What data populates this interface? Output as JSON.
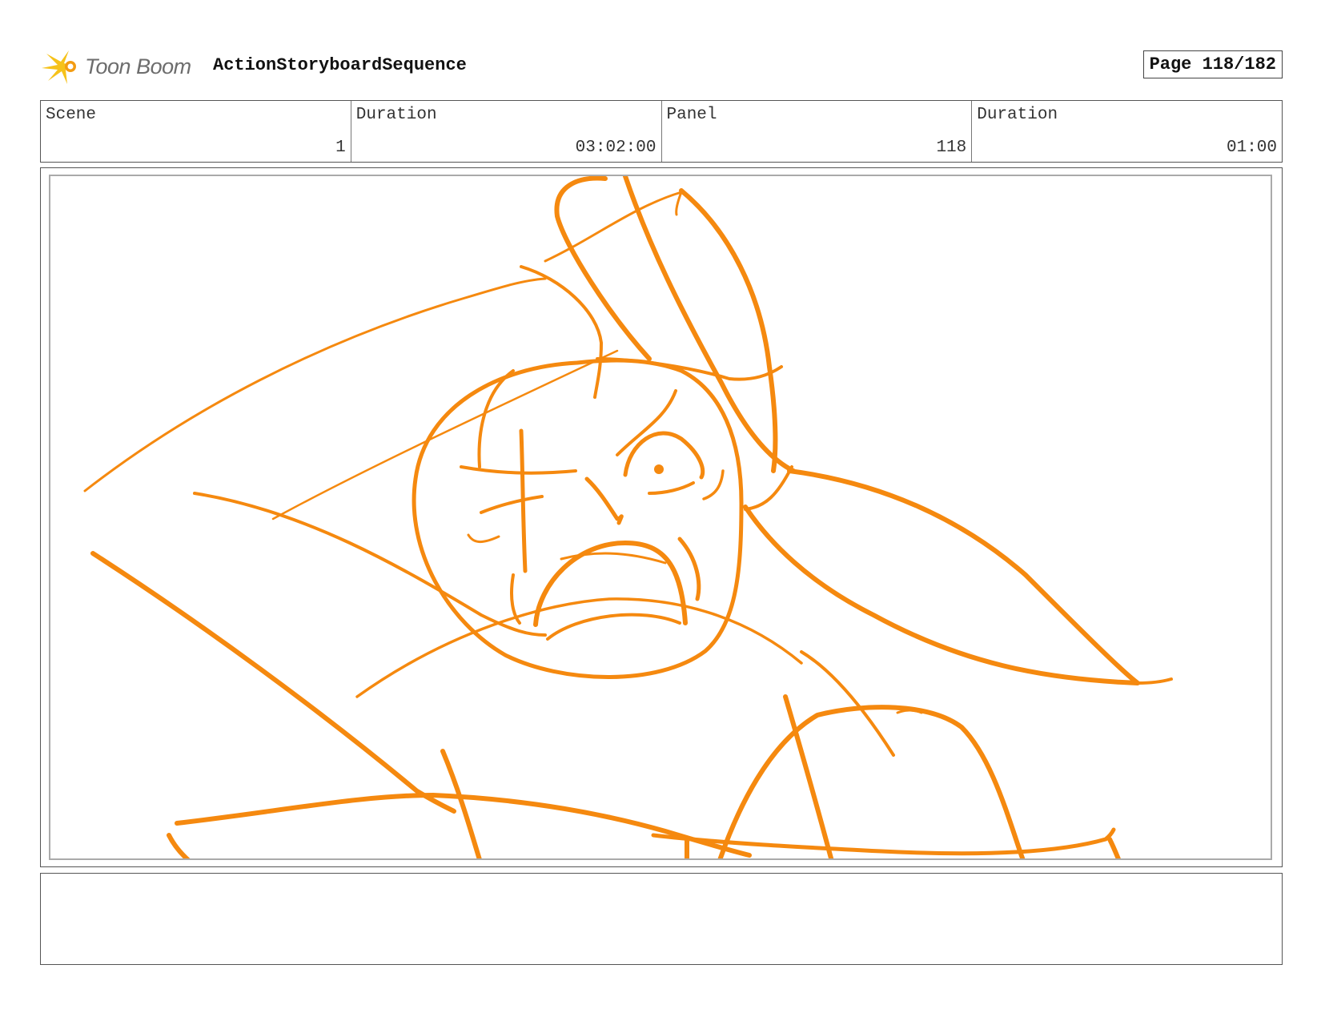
{
  "header": {
    "brand_name": "Toon Boom",
    "project_title": "ActionStoryboardSequence",
    "page_label": "Page 118/182"
  },
  "info": {
    "scene_label": "Scene",
    "scene_value": "1",
    "scene_duration_label": "Duration",
    "scene_duration_value": "03:02:00",
    "panel_label": "Panel",
    "panel_value": "118",
    "panel_duration_label": "Duration",
    "panel_duration_value": "01:00"
  },
  "sketch": {
    "stroke_color": "#f5890f"
  },
  "notes": {
    "text": ""
  }
}
